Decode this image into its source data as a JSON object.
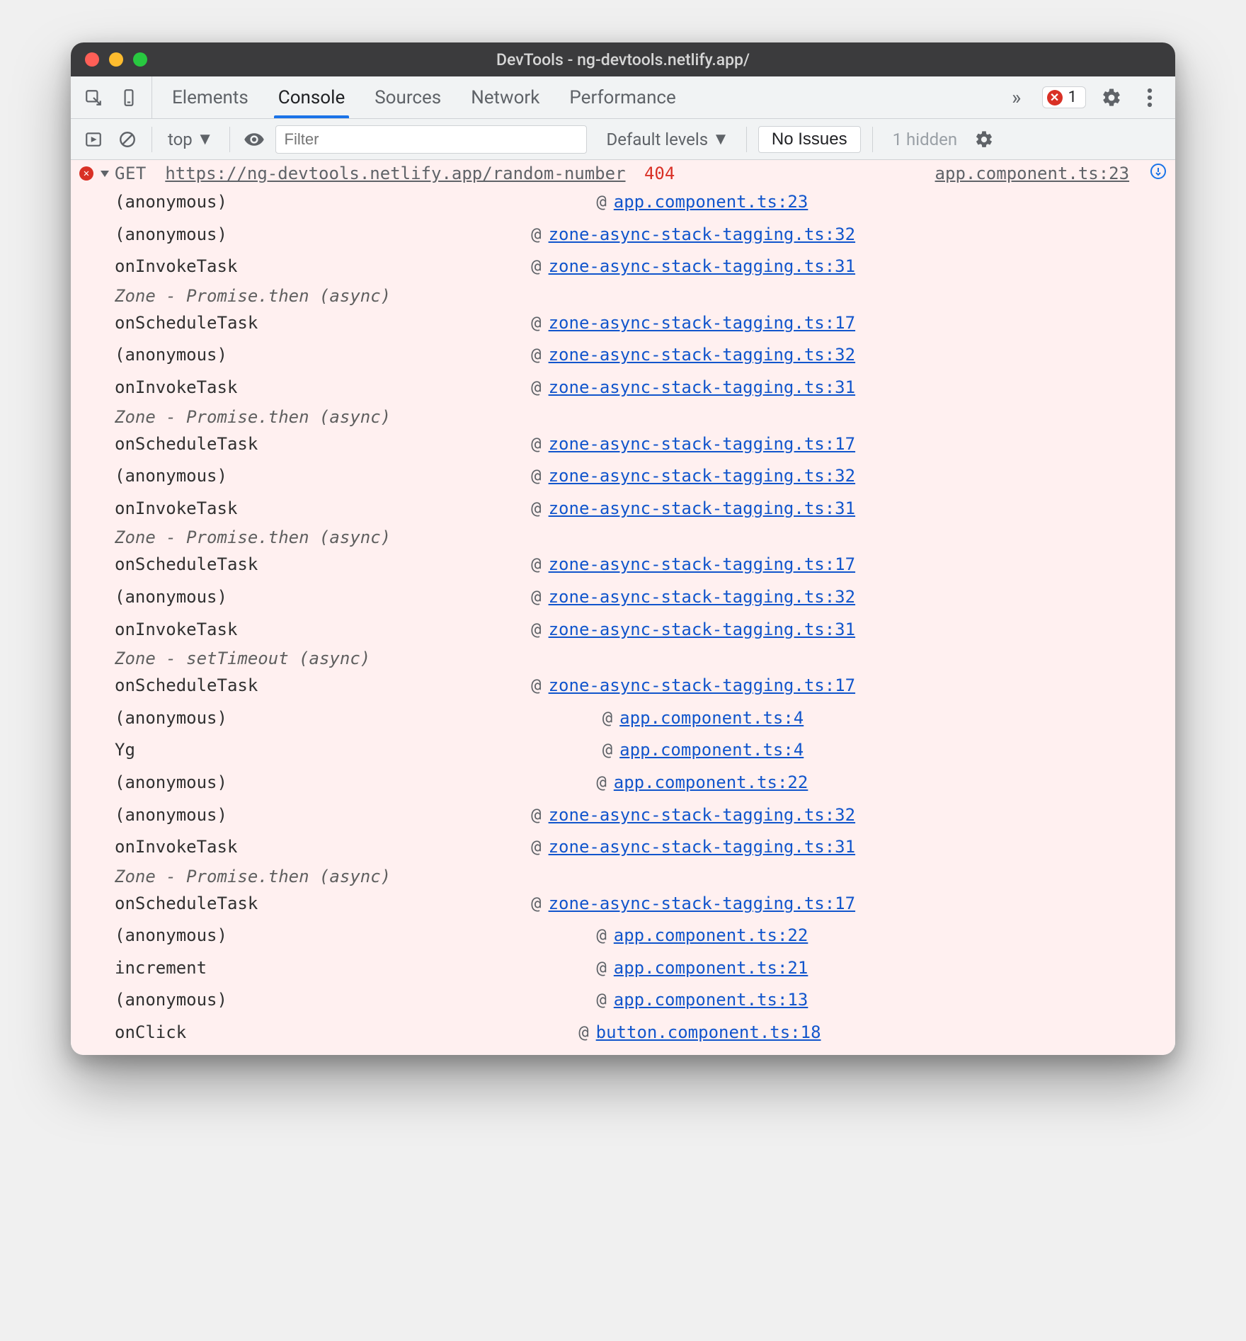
{
  "window": {
    "title": "DevTools - ng-devtools.netlify.app/"
  },
  "tabs": {
    "items": [
      "Elements",
      "Console",
      "Sources",
      "Network",
      "Performance"
    ],
    "activeIndex": 1,
    "more": "»"
  },
  "errorBadge": {
    "count": "1"
  },
  "toolbar": {
    "context": "top",
    "filter_placeholder": "Filter",
    "levels": "Default levels",
    "noIssues": "No Issues",
    "hidden": "1 hidden"
  },
  "error": {
    "method": "GET",
    "url": "https://ng-devtools.netlify.app/random-number",
    "status": "404",
    "origin": "app.component.ts:23"
  },
  "trace": [
    {
      "type": "frame",
      "fn": "(anonymous)",
      "src": "app.component.ts:23"
    },
    {
      "type": "frame",
      "fn": "(anonymous)",
      "src": "zone-async-stack-tagging.ts:32"
    },
    {
      "type": "frame",
      "fn": "onInvokeTask",
      "src": "zone-async-stack-tagging.ts:31"
    },
    {
      "type": "zone",
      "label": "Zone - Promise.then (async)"
    },
    {
      "type": "frame",
      "fn": "onScheduleTask",
      "src": "zone-async-stack-tagging.ts:17"
    },
    {
      "type": "frame",
      "fn": "(anonymous)",
      "src": "zone-async-stack-tagging.ts:32"
    },
    {
      "type": "frame",
      "fn": "onInvokeTask",
      "src": "zone-async-stack-tagging.ts:31"
    },
    {
      "type": "zone",
      "label": "Zone - Promise.then (async)"
    },
    {
      "type": "frame",
      "fn": "onScheduleTask",
      "src": "zone-async-stack-tagging.ts:17"
    },
    {
      "type": "frame",
      "fn": "(anonymous)",
      "src": "zone-async-stack-tagging.ts:32"
    },
    {
      "type": "frame",
      "fn": "onInvokeTask",
      "src": "zone-async-stack-tagging.ts:31"
    },
    {
      "type": "zone",
      "label": "Zone - Promise.then (async)"
    },
    {
      "type": "frame",
      "fn": "onScheduleTask",
      "src": "zone-async-stack-tagging.ts:17"
    },
    {
      "type": "frame",
      "fn": "(anonymous)",
      "src": "zone-async-stack-tagging.ts:32"
    },
    {
      "type": "frame",
      "fn": "onInvokeTask",
      "src": "zone-async-stack-tagging.ts:31"
    },
    {
      "type": "zone",
      "label": "Zone - setTimeout (async)"
    },
    {
      "type": "frame",
      "fn": "onScheduleTask",
      "src": "zone-async-stack-tagging.ts:17"
    },
    {
      "type": "frame",
      "fn": "(anonymous)",
      "src": "app.component.ts:4"
    },
    {
      "type": "frame",
      "fn": "Yg",
      "src": "app.component.ts:4"
    },
    {
      "type": "frame",
      "fn": "(anonymous)",
      "src": "app.component.ts:22"
    },
    {
      "type": "frame",
      "fn": "(anonymous)",
      "src": "zone-async-stack-tagging.ts:32"
    },
    {
      "type": "frame",
      "fn": "onInvokeTask",
      "src": "zone-async-stack-tagging.ts:31"
    },
    {
      "type": "zone",
      "label": "Zone - Promise.then (async)"
    },
    {
      "type": "frame",
      "fn": "onScheduleTask",
      "src": "zone-async-stack-tagging.ts:17"
    },
    {
      "type": "frame",
      "fn": "(anonymous)",
      "src": "app.component.ts:22"
    },
    {
      "type": "frame",
      "fn": "increment",
      "src": "app.component.ts:21"
    },
    {
      "type": "frame",
      "fn": "(anonymous)",
      "src": "app.component.ts:13"
    },
    {
      "type": "frame",
      "fn": "onClick",
      "src": "button.component.ts:18"
    }
  ]
}
